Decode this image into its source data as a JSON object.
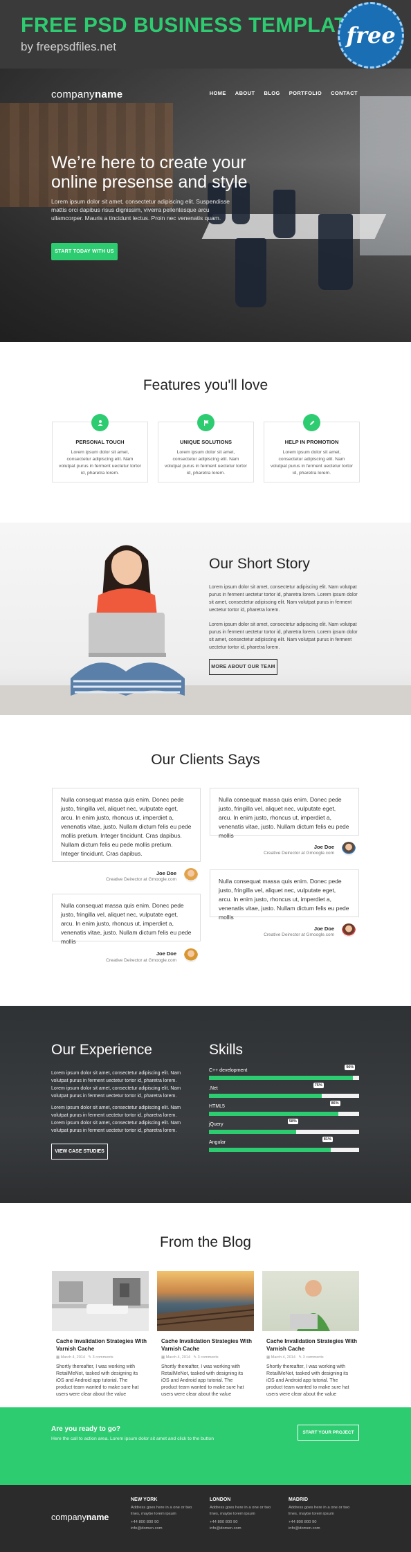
{
  "banner": {
    "title": "FREE PSD BUSINESS TEMPLATE",
    "subtitle": "by freepsdfiles.net",
    "badge": "free"
  },
  "header": {
    "logo_light": "company",
    "logo_bold": "name",
    "nav": [
      "HOME",
      "ABOUT",
      "BLOG",
      "PORTFOLIO",
      "CONTACT"
    ]
  },
  "hero": {
    "title": "We’re here to create your online presense and style",
    "text": "Lorem ipsum dolor sit amet, consectetur adipiscing elit. Suspendisse mattis orci dapibus risus dignissim, viverra pellentesque arcu ullamcorper. Mauris a tincidunt lectus. Proin nec venenatis quam.",
    "button": "START TODAY WITH US"
  },
  "features": {
    "title": "Features you'll love",
    "items": [
      {
        "icon": "person-icon",
        "title": "PERSONAL TOUCH",
        "text": "Lorem ipsum dolor sit amet, consectetur adipiscing elit. Nam volutpat purus in ferment uectetur tortor id, pharetra lorem."
      },
      {
        "icon": "flag-icon",
        "title": "UNIQUE SOLUTIONS",
        "text": "Lorem ipsum dolor sit amet, consectetur adipiscing elit. Nam volutpat purus in ferment uectetur tortor id, pharetra lorem."
      },
      {
        "icon": "pencil-icon",
        "title": "HELP IN PROMOTION",
        "text": "Lorem ipsum dolor sit amet, consectetur adipiscing elit. Nam volutpat purus in ferment uectetur tortor id, pharetra lorem."
      }
    ]
  },
  "story": {
    "title": "Our Short Story",
    "p1": "Lorem ipsum dolor sit amet, consectetur adipiscing elit. Nam volutpat purus in ferment uectetur tortor id, pharetra lorem. Lorem ipsum dolor sit amet, consectetur adipiscing elit. Nam volutpat purus in ferment uectetur tortor id, pharetra lorem.",
    "p2": "Lorem ipsum dolor sit amet, consectetur adipiscing elit. Nam volutpat purus in ferment uectetur tortor id, pharetra lorem. Lorem ipsum dolor sit amet, consectetur adipiscing elit. Nam volutpat purus in ferment uectetur tortor id, pharetra lorem.",
    "button": "MORE ABOUT OUR TEAM"
  },
  "clients": {
    "title": "Our Clients Says",
    "items": [
      {
        "text": "Nulla consequat massa quis enim. Donec pede justo, fringilla vel, aliquet nec, vulputate eget, arcu. In enim justo, rhoncus ut, imperdiet a, venenatis vitae, justo. Nullam dictum felis eu pede mollis pretium. Integer tincidunt. Cras dapibus. Nullam dictum felis eu pede mollis pretium. Integer tincidunt. Cras dapibus.",
        "name": "Joe Doe",
        "role": "Creative Deirector at Gmoogle.com"
      },
      {
        "text": "Nulla consequat massa quis enim. Donec pede justo, fringilla vel, aliquet nec, vulputate eget, arcu. In enim justo, rhoncus ut, imperdiet a, venenatis vitae, justo. Nullam dictum felis eu pede mollis",
        "name": "Joe Doe",
        "role": "Creative Deirector at Gmoogle.com"
      },
      {
        "text": "Nulla consequat massa quis enim. Donec pede justo, fringilla vel, aliquet nec, vulputate eget, arcu. In enim justo, rhoncus ut, imperdiet a, venenatis vitae, justo. Nullam dictum felis eu pede mollis",
        "name": "Joe Doe",
        "role": "Creative Deirector at Gmoogle.com"
      },
      {
        "text": "Nulla consequat massa quis enim. Donec pede justo, fringilla vel, aliquet nec, vulputate eget, arcu. In enim justo, rhoncus ut, imperdiet a, venenatis vitae, justo. Nullam dictum felis eu pede mollis",
        "name": "Joe Doe",
        "role": "Creative Deirector at Gmoogle.com"
      }
    ]
  },
  "experience": {
    "title": "Our Experience",
    "p1": "Lorem ipsum dolor sit amet, consectetur adipiscing elit. Nam volutpat purus in ferment uectetur tortor id, pharetra lorem. Lorem ipsum dolor sit amet, consectetur adipiscing elit. Nam volutpat purus in ferment uectetur tortor id, pharetra lorem.",
    "p2": "Lorem ipsum dolor sit amet, consectetur adipiscing elit. Nam volutpat purus in ferment uectetur tortor id, pharetra lorem. Lorem ipsum dolor sit amet, consectetur adipiscing elit. Nam volutpat purus in ferment uectetur tortor id, pharetra lorem.",
    "button": "VIEW CASE STUDIES"
  },
  "skills": {
    "title": "Skills",
    "items": [
      {
        "label": "C++ development",
        "value": 96,
        "pct": "96%"
      },
      {
        "label": ".Net",
        "value": 75,
        "pct": "75%"
      },
      {
        "label": "HTML5",
        "value": 86,
        "pct": "86%"
      },
      {
        "label": "jQuery",
        "value": 58,
        "pct": "58%"
      },
      {
        "label": "Angular",
        "value": 81,
        "pct": "81%"
      }
    ]
  },
  "blog": {
    "title": "From the Blog",
    "posts": [
      {
        "title": "Cache Invalidation Strategies With Varnish Cache",
        "date": "March 4, 2014",
        "comments": "3 comments",
        "text": "Shortly thereafter, I was working with RetailMeNot, tasked with designing its iOS and Android app tutorial. The product team wanted to make sure hat users were clear about the value"
      },
      {
        "title": "Cache Invalidation Strategies With Varnish Cache",
        "date": "March 4, 2014",
        "comments": "3 comments",
        "text": "Shortly thereafter, I was working with RetailMeNot, tasked with designing its iOS and Android app tutorial. The product team wanted to make sure hat users were clear about the value"
      },
      {
        "title": "Cache Invalidation Strategies With Varnish Cache",
        "date": "March 4, 2014",
        "comments": "3 comments",
        "text": "Shortly thereafter, I was working with RetailMeNot, tasked with designing its iOS and Android app tutorial. The product team wanted to make sure hat users were clear about the value"
      }
    ]
  },
  "cta": {
    "heading": "Are you ready to go?",
    "sub": "Here the call to action area. Lorem ipsum dolor sit amet and click to the button",
    "button": "START YOUR PROJECT"
  },
  "footer": {
    "logo_light": "company",
    "logo_bold": "name",
    "cols": [
      {
        "city": "NEW YORK",
        "address": "Address goes here in a one or two lines, maybe lorem ipsum",
        "phone": "+44 800 800 90",
        "email": "info@domen.com"
      },
      {
        "city": "LONDON",
        "address": "Address goes here in a one or two lines, maybe lorem ipsum",
        "phone": "+44 800 800 90",
        "email": "info@domen.com"
      },
      {
        "city": "MADRID",
        "address": "Address goes here in a one or two lines, maybe lorem ipsum",
        "phone": "+44 800 800 90",
        "email": "info@domen.com"
      }
    ]
  },
  "colors": {
    "accent": "#2ecc71",
    "dark": "#2b2b2b",
    "badge": "#1a6fb4"
  }
}
